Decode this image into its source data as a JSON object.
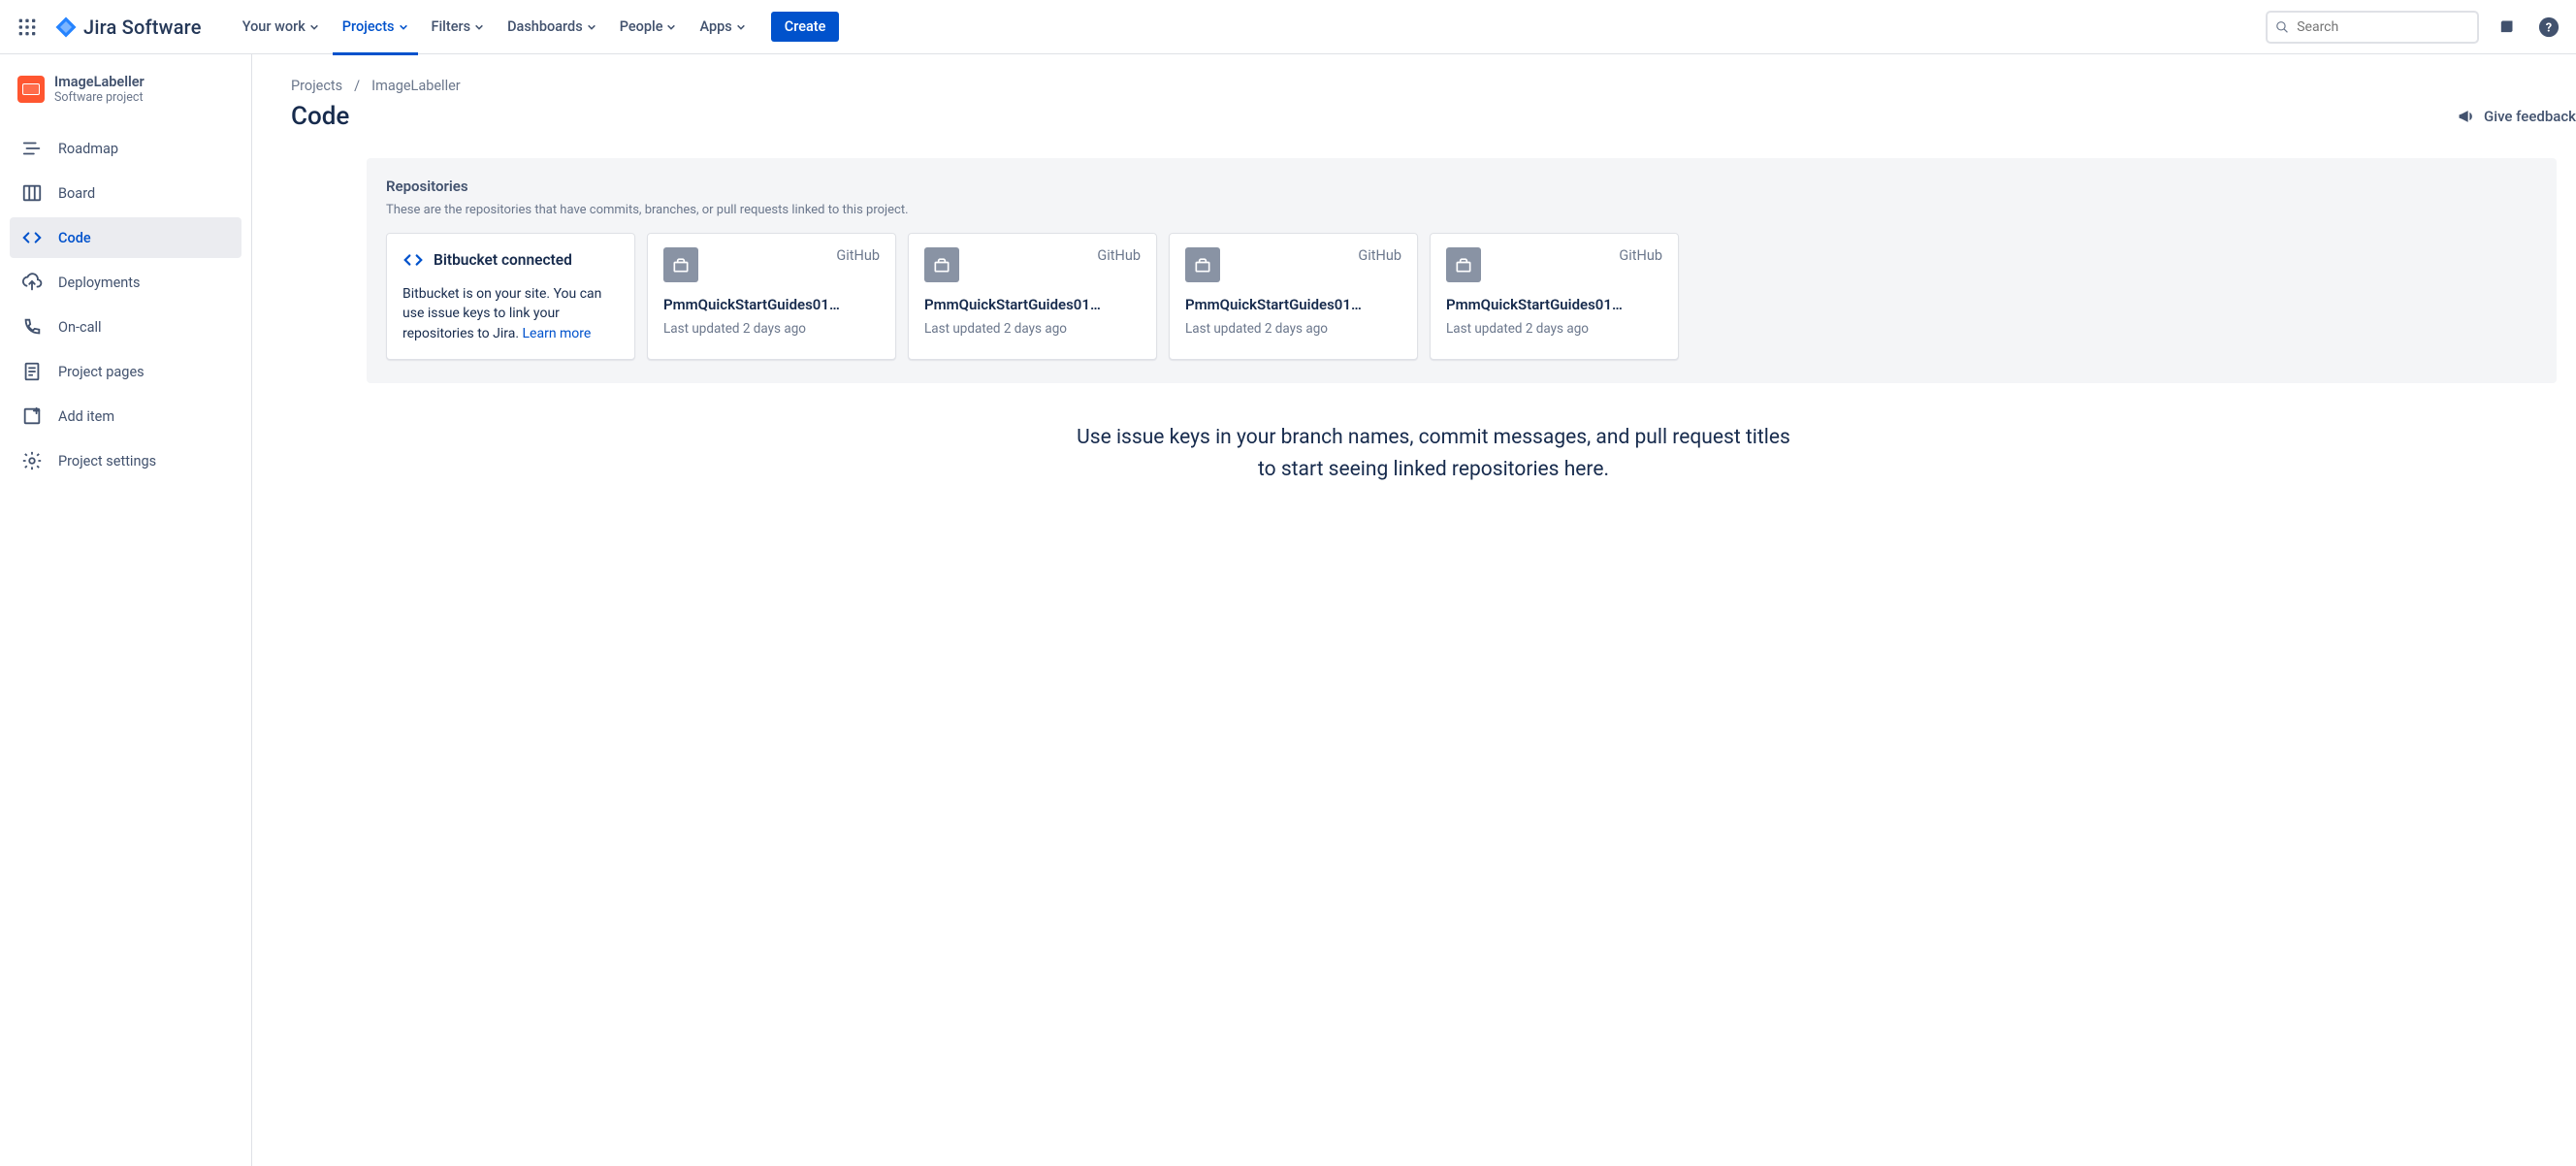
{
  "topnav": {
    "logo_text": "Jira Software",
    "items": [
      {
        "label": "Your work"
      },
      {
        "label": "Projects"
      },
      {
        "label": "Filters"
      },
      {
        "label": "Dashboards"
      },
      {
        "label": "People"
      },
      {
        "label": "Apps"
      }
    ],
    "active_index": 1,
    "create_label": "Create",
    "search_placeholder": "Search"
  },
  "sidebar": {
    "project_name": "ImageLabeller",
    "project_type": "Software project",
    "items": [
      {
        "label": "Roadmap"
      },
      {
        "label": "Board"
      },
      {
        "label": "Code"
      },
      {
        "label": "Deployments"
      },
      {
        "label": "On-call"
      },
      {
        "label": "Project pages"
      },
      {
        "label": "Add item"
      },
      {
        "label": "Project settings"
      }
    ],
    "active_index": 2
  },
  "breadcrumbs": {
    "root": "Projects",
    "current": "ImageLabeller"
  },
  "page": {
    "title": "Code",
    "feedback_label": "Give feedback"
  },
  "repos_panel": {
    "title": "Repositories",
    "subtitle": "These are the repositories that have commits, branches, or pull requests linked to this project."
  },
  "bitbucket_card": {
    "title": "Bitbucket connected",
    "body": "Bitbucket is on your site. You can use issue keys to link your repositories to Jira. ",
    "link_label": "Learn more"
  },
  "repos": [
    {
      "provider": "GitHub",
      "name": "PmmQuickStartGuides01…",
      "updated": "Last updated 2 days ago"
    },
    {
      "provider": "GitHub",
      "name": "PmmQuickStartGuides01…",
      "updated": "Last updated 2 days ago"
    },
    {
      "provider": "GitHub",
      "name": "PmmQuickStartGuides01…",
      "updated": "Last updated 2 days ago"
    },
    {
      "provider": "GitHub",
      "name": "PmmQuickStartGuides01…",
      "updated": "Last updated 2 days ago"
    }
  ],
  "cta": {
    "line1": "Use issue keys in your branch names, commit messages, and pull request titles",
    "line2": "to start seeing linked repositories here."
  }
}
